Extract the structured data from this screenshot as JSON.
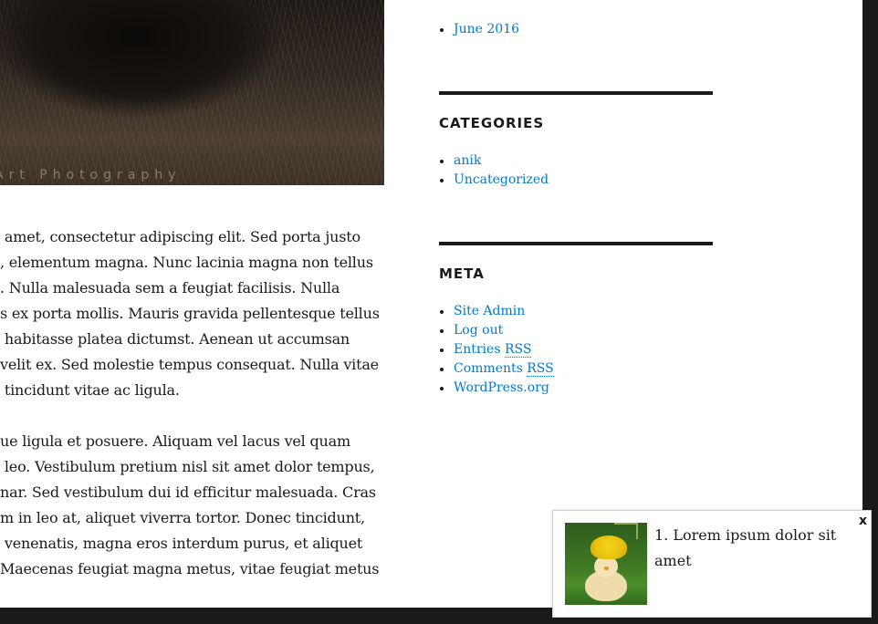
{
  "hero": {
    "watermark": "Art Photography"
  },
  "content": {
    "paragraphs": [
      [
        " amet, consectetur adipiscing elit. Sed porta justo",
        ", elementum magna. Nunc lacinia magna non tellus",
        ". Nulla malesuada sem a feugiat facilisis. Nulla",
        "s ex porta mollis. Mauris gravida pellentesque tellus",
        " habitasse platea dictumst. Aenean ut accumsan",
        "velit ex. Sed molestie tempus consequat. Nulla vitae",
        " tincidunt vitae ac ligula."
      ],
      [
        "ue ligula et posuere. Aliquam vel lacus vel quam",
        " leo. Vestibulum pretium nisl sit amet dolor tempus,",
        "nar. Sed vestibulum dui id efficitur malesuada. Cras",
        "m in leo at, aliquet viverra tortor. Donec tincidunt,",
        " venenatis, magna eros interdum purus, et aliquet",
        "Maecenas feugiat magna metus, vitae feugiat metus"
      ]
    ]
  },
  "sidebar": {
    "archives": {
      "items": [
        "June 2016"
      ]
    },
    "categories": {
      "title": "CATEGORIES",
      "items": [
        "anik",
        "Uncategorized"
      ]
    },
    "meta": {
      "title": "META",
      "items": [
        {
          "label": "Site Admin"
        },
        {
          "label": "Log out"
        },
        {
          "label": "Entries ",
          "abbr": "RSS"
        },
        {
          "label": "Comments ",
          "abbr": "RSS"
        },
        {
          "label": "WordPress.org"
        }
      ]
    }
  },
  "popup": {
    "close_label": "x",
    "title": "1. Lorem ipsum dolor sit amet"
  }
}
